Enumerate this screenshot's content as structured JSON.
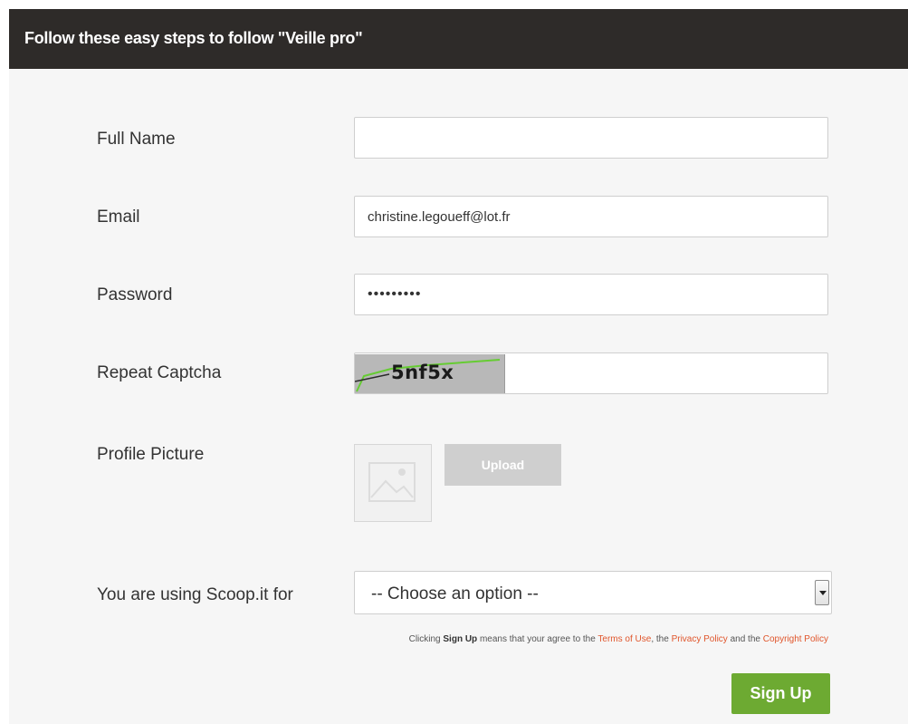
{
  "header": {
    "title": "Follow these easy steps to follow \"Veille pro\""
  },
  "form": {
    "full_name": {
      "label": "Full Name",
      "value": ""
    },
    "email": {
      "label": "Email",
      "value": "christine.legoueff@lot.fr"
    },
    "password": {
      "label": "Password",
      "value": "•••••••••"
    },
    "captcha": {
      "label": "Repeat Captcha",
      "image_text": "5nf5x",
      "value": ""
    },
    "profile_picture": {
      "label": "Profile Picture",
      "upload_label": "Upload",
      "placeholder_icon": "image-placeholder-icon"
    },
    "usage": {
      "label": "You are using Scoop.it for",
      "selected": "-- Choose an option --"
    },
    "terms": {
      "prefix": "Clicking ",
      "action": "Sign Up",
      "middle": " means that your agree to the ",
      "terms_link": "Terms of Use",
      "sep1": ", the ",
      "privacy_link": "Privacy Policy",
      "sep2": " and the ",
      "copyright_link": "Copyright Policy"
    },
    "submit_label": "Sign Up"
  },
  "colors": {
    "header_bg": "#2e2b29",
    "panel_bg": "#f6f6f6",
    "accent_green": "#6daa32",
    "link_orange": "#e0552b",
    "upload_disabled": "#cfcfcf"
  }
}
